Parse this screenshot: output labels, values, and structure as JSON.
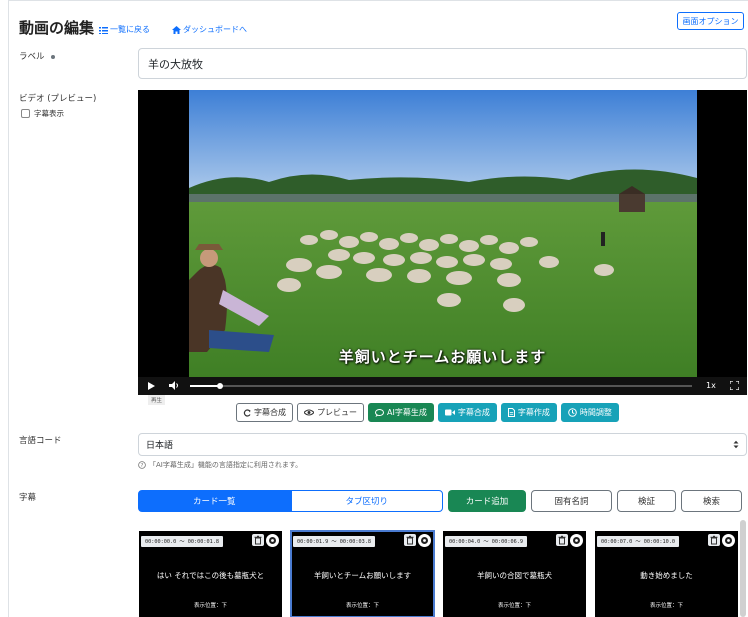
{
  "header": {
    "title": "動画の編集",
    "back_link": "一覧に戻る",
    "dashboard_link": "ダッシュボードへ",
    "options_button": "画面オプション"
  },
  "form": {
    "label_field": {
      "label": "ラベル",
      "value": "羊の大放牧"
    },
    "video": {
      "label": "ビデオ (プレビュー)",
      "subtitle_toggle": "字幕表示",
      "current_subtitle": "羊飼いとチームお願いします",
      "speed": "1x",
      "progress": 0.06,
      "tooltip": "再生"
    },
    "actions": [
      {
        "label": "字幕合成",
        "style": "outline",
        "icon": "refresh-icon"
      },
      {
        "label": "プレビュー",
        "style": "outline",
        "icon": "eye-icon"
      },
      {
        "label": "AI字幕生成",
        "style": "green",
        "icon": "chat-icon"
      },
      {
        "label": "字幕合成",
        "style": "teal",
        "icon": "video-camera-icon"
      },
      {
        "label": "字幕作成",
        "style": "teal",
        "icon": "document-icon"
      },
      {
        "label": "時間調整",
        "style": "teal",
        "icon": "clock-icon"
      }
    ],
    "language": {
      "label": "言語コード",
      "value": "日本語",
      "help": "「AI字幕生成」機能の言語指定に利用されます。"
    },
    "subtitles": {
      "label": "字幕",
      "view_tabs": [
        "カード一覧",
        "タブ区切り"
      ],
      "add_button": "カード追加",
      "proper_noun_button": "固有名詞",
      "verify_button": "検証",
      "search_button": "検索",
      "cards": [
        {
          "time": "00:00:00.0 〜 00:00:01.8",
          "text": "はい それではこの後も墓瓶犬と",
          "position": "表示位置：下"
        },
        {
          "time": "00:00:01.9 〜 00:00:03.8",
          "text": "羊飼いとチームお願いします",
          "position": "表示位置：下"
        },
        {
          "time": "00:00:04.0 〜 00:00:06.9",
          "text": "羊飼いの合図で墓瓶犬",
          "position": "表示位置：下"
        },
        {
          "time": "00:00:07.0 〜 00:00:10.0",
          "text": "動き始めました",
          "position": "表示位置：下"
        }
      ]
    }
  },
  "colors": {
    "primary": "#0d6efd",
    "green": "#198754",
    "teal": "#17a2b8"
  }
}
